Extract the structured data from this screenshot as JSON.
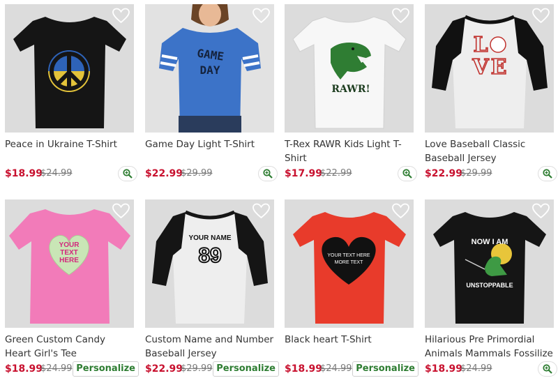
{
  "colors": {
    "price": "#c8102e",
    "personalize": "#2e7d32",
    "image_bg": "#dcdcdc"
  },
  "icons": {
    "favorite": "heart-outline-icon",
    "quick_view": "zoom-in-icon"
  },
  "products": [
    {
      "title": "Peace in Ukraine T-Shirt",
      "price": "$18.99",
      "old_price": "$24.99",
      "action": "zoom",
      "art_text": ""
    },
    {
      "title": "Game Day Light T-Shirt",
      "price": "$22.99",
      "old_price": "$29.99",
      "action": "zoom",
      "art_text": "GAME DAY"
    },
    {
      "title": "T-Rex RAWR Kids Light T-Shirt",
      "price": "$17.99",
      "old_price": "$22.99",
      "action": "zoom",
      "art_text": "RAWR!"
    },
    {
      "title": "Love Baseball Classic Baseball Jersey",
      "price": "$22.99",
      "old_price": "$29.99",
      "action": "zoom",
      "art_text": "LOVE"
    },
    {
      "title": "Green Custom Candy Heart Girl's Tee",
      "price": "$18.99",
      "old_price": "$24.99",
      "action": "personalize",
      "art_text": "YOUR TEXT HERE"
    },
    {
      "title": "Custom Name and Number Baseball Jersey",
      "price": "$22.99",
      "old_price": "$29.99",
      "action": "personalize",
      "art_text": "YOUR NAME 89"
    },
    {
      "title": "Black heart T-Shirt",
      "price": "$18.99",
      "old_price": "$24.99",
      "action": "personalize",
      "art_text": "YOUR TEXT HERE MORE TEXT"
    },
    {
      "title": "Hilarious Pre Primordial Animals Mammals Fossilize",
      "price": "$18.99",
      "old_price": "$24.99",
      "action": "zoom",
      "art_text": "NOW I AM UNSTOPPABLE"
    }
  ],
  "personalize_label": "Personalize"
}
